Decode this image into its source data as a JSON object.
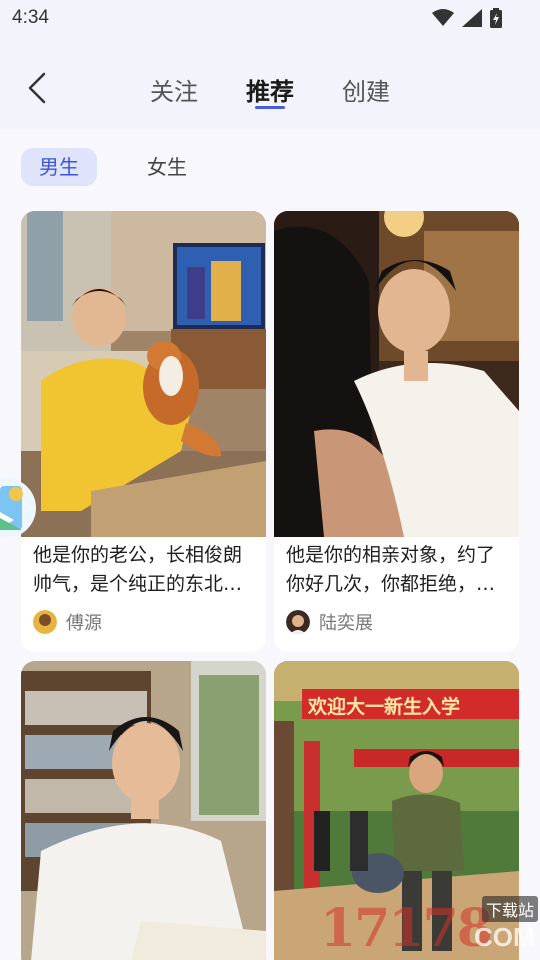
{
  "status": {
    "time": "4:34"
  },
  "header": {
    "tabs": [
      {
        "label": "关注"
      },
      {
        "label": "推荐"
      },
      {
        "label": "创建"
      }
    ]
  },
  "gender_tabs": [
    {
      "label": "男生"
    },
    {
      "label": "女生"
    }
  ],
  "cards": [
    {
      "desc": "他是你的老公，长相俊朗帅气，是个纯正的东北…",
      "author": "傅源"
    },
    {
      "desc": "他是你的相亲对象，约了你好几次，你都拒绝，…",
      "author": "陆奕展"
    },
    {
      "desc": "",
      "author": ""
    },
    {
      "desc": "",
      "author": "",
      "banner": "欢迎大一新生入学"
    }
  ],
  "watermark": {
    "text": "17178",
    "sub": "下载站",
    "suffix": "COM"
  },
  "colors": {
    "accent": "#4a5bdc",
    "chip_bg": "#dfe3fb",
    "chip_text": "#3c55d6"
  }
}
